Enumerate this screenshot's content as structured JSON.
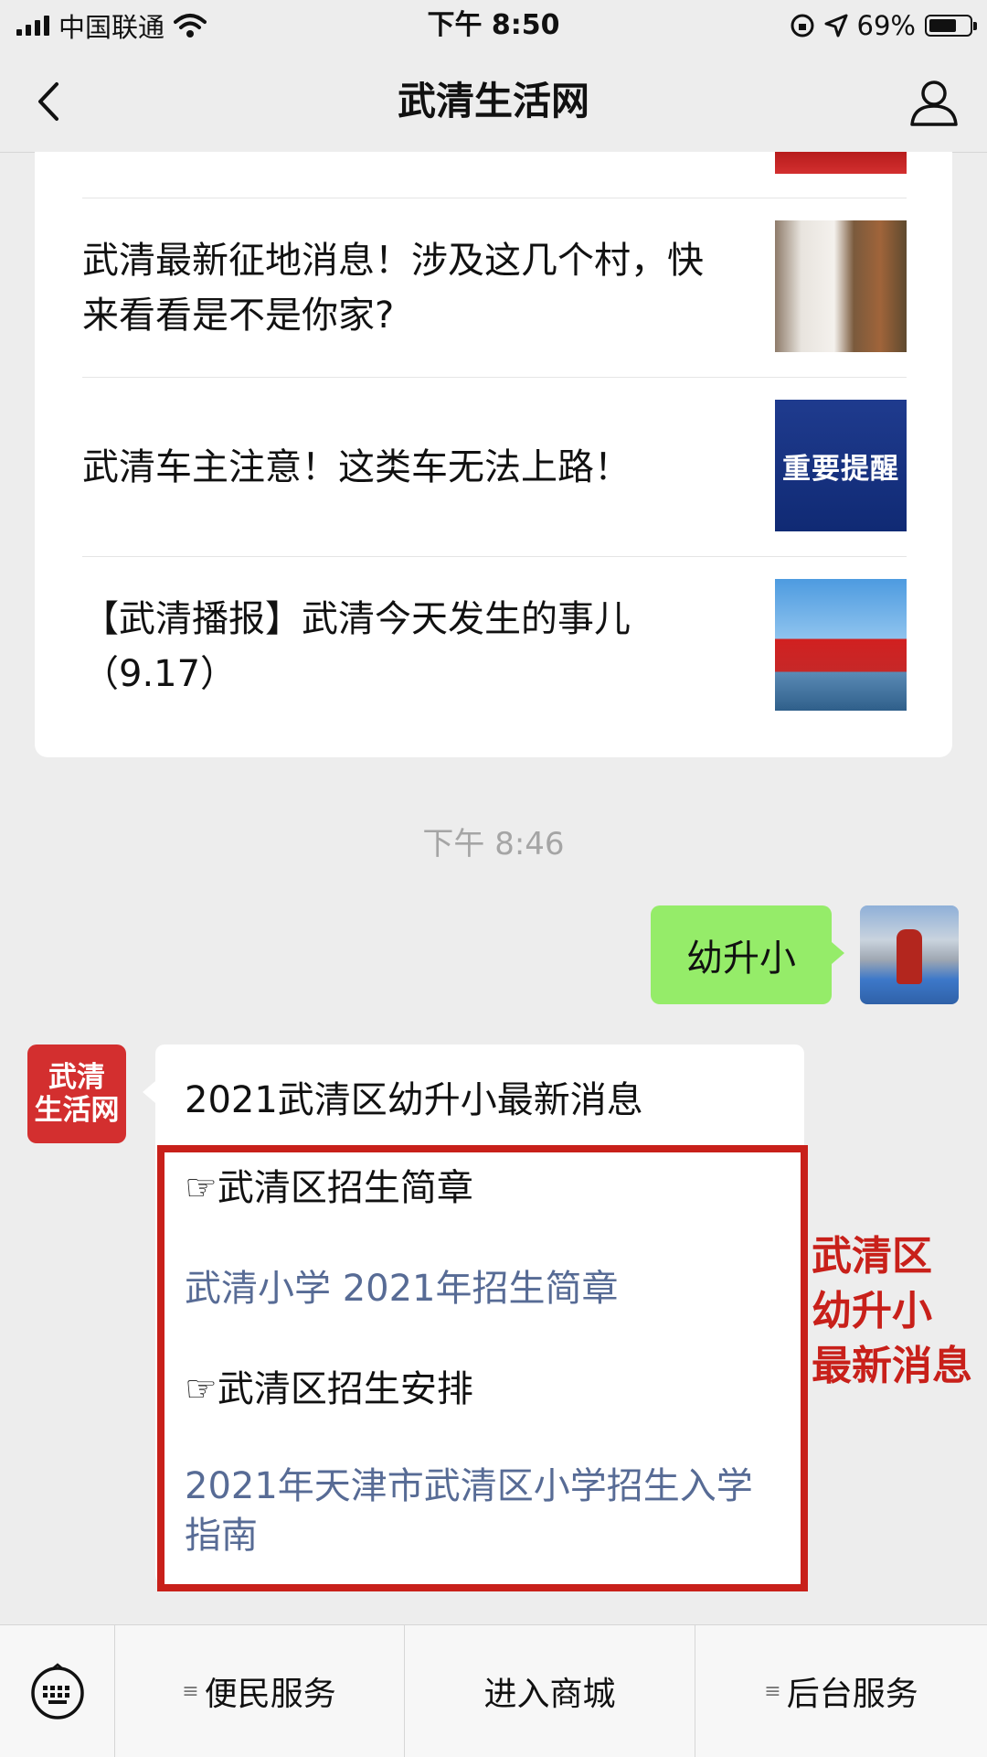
{
  "status_bar": {
    "carrier": "中国联通",
    "time": "下午 8:50",
    "battery": "69%"
  },
  "nav": {
    "title": "武清生活网"
  },
  "articles": [
    {
      "title": "武清最新征地消息！涉及这几个村，快来看看是不是你家?"
    },
    {
      "title": "武清车主注意！这类车无法上路！",
      "thumb_text": "重要提醒"
    },
    {
      "title": "【武清播报】武清今天发生的事儿 （9.17）"
    }
  ],
  "chat": {
    "timestamp": "下午 8:46",
    "sent_message": "幼升小",
    "brand_avatar": {
      "line1": "武清",
      "line2": "生活网"
    },
    "reply": {
      "title": "2021武清区幼升小最新消息",
      "items": [
        {
          "text": "☞武清区招生简章"
        },
        {
          "text": "武清小学 2021年招生简章"
        },
        {
          "text": "☞武清区招生安排"
        },
        {
          "text": "2021年天津市武清区小学招生入学指南"
        }
      ]
    },
    "side_note": [
      "武清区",
      "幼升小",
      "最新消息"
    ],
    "highlight_color": "#c8201a"
  },
  "bottom_menu": {
    "keyboard_icon": "keyboard-icon",
    "items": [
      {
        "label": "便民服务"
      },
      {
        "label": "进入商城"
      },
      {
        "label": "后台服务"
      }
    ]
  }
}
